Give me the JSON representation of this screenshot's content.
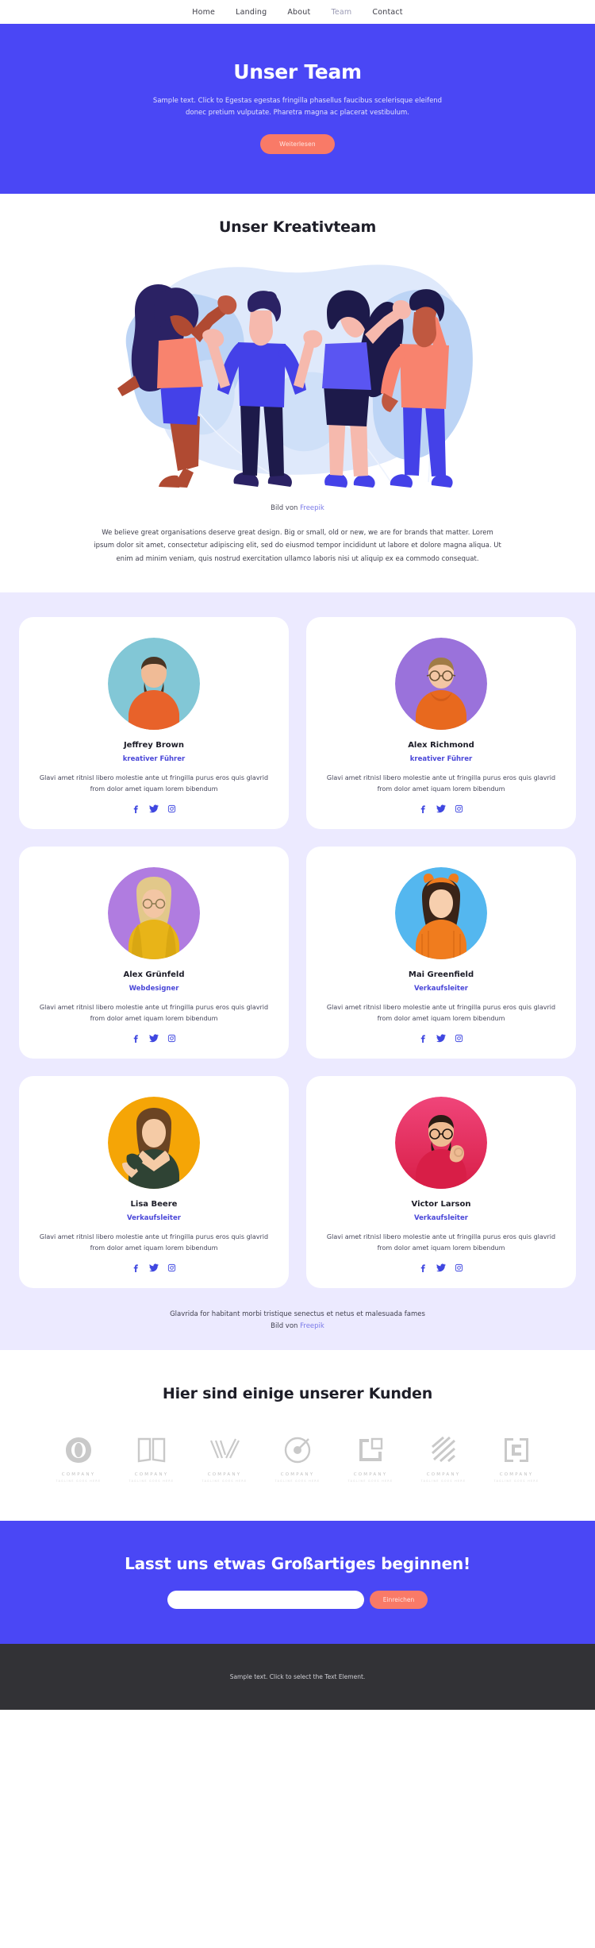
{
  "nav": {
    "items": [
      {
        "label": "Home",
        "active": false
      },
      {
        "label": "Landing",
        "active": false
      },
      {
        "label": "About",
        "active": false
      },
      {
        "label": "Team",
        "active": true
      },
      {
        "label": "Contact",
        "active": false
      }
    ]
  },
  "hero": {
    "title": "Unser Team",
    "subtitle": "Sample text. Click to Egestas egestas fringilla phasellus faucibus scelerisque eleifend donec pretium vulputate. Pharetra magna ac placerat vestibulum.",
    "button_label": "Weiterlesen",
    "bg_color": "#4a47f5",
    "button_color": "#f97a67"
  },
  "creative": {
    "title": "Unser Kreativteam",
    "illustration_name": "team-celebration-illustration",
    "caption_prefix": "Bild von ",
    "caption_link": "Freepik",
    "body": "We believe great organisations deserve great design. Big or small, old or new, we are for brands that matter. Lorem ipsum dolor sit amet, consectetur adipiscing elit, sed do eiusmod tempor incididunt ut labore et dolore magna aliqua. Ut enim ad minim veniam, quis nostrud exercitation ullamco laboris nisi ut aliquip ex ea commodo consequat."
  },
  "team": {
    "bg_color": "#eceaff",
    "role_color": "#4a47d8",
    "members": [
      {
        "name": "Jeffrey Brown",
        "role": "kreativer Führer",
        "desc": "Glavi amet ritnisl libero molestie ante ut fringilla purus eros quis glavrid from dolor amet iquam lorem bibendum",
        "avatar_bg": "#82c7d6",
        "shirt": "#e8622a",
        "hair": "#4a3524",
        "skin": "#f0bb96"
      },
      {
        "name": "Alex Richmond",
        "role": "kreativer Führer",
        "desc": "Glavi amet ritnisl libero molestie ante ut fringilla purus eros quis glavrid from dolor amet iquam lorem bibendum",
        "avatar_bg": "#9a72db",
        "shirt": "#e8691e",
        "hair": "#a07c46",
        "skin": "#f3c6a4"
      },
      {
        "name": "Alex Grünfeld",
        "role": "Webdesigner",
        "desc": "Glavi amet ritnisl libero molestie ante ut fringilla purus eros quis glavrid from dolor amet iquam lorem bibendum",
        "avatar_bg": "#b07ce0",
        "shirt": "#e8b418",
        "hair": "#e2c88a",
        "skin": "#f3c6a4"
      },
      {
        "name": "Mai Greenfield",
        "role": "Verkaufsleiter",
        "desc": "Glavi amet ritnisl libero molestie ante ut fringilla purus eros quis glavrid from dolor amet iquam lorem bibendum",
        "avatar_bg": "#54b7ef",
        "shirt": "#f07c1e",
        "hair": "#3a2418",
        "skin": "#f7cfae"
      },
      {
        "name": "Lisa Beere",
        "role": "Verkaufsleiter",
        "desc": "Glavi amet ritnisl libero molestie ante ut fringilla purus eros quis glavrid from dolor amet iquam lorem bibendum",
        "avatar_bg": "#f5a506",
        "shirt": "#2f4334",
        "hair": "#6b4423",
        "skin": "#f5cba6"
      },
      {
        "name": "Victor Larson",
        "role": "Verkaufsleiter",
        "desc": "Glavi amet ritnisl libero molestie ante ut fringilla purus eros quis glavrid from dolor amet iquam lorem bibendum",
        "avatar_bg": "#e8275f",
        "shirt": "#d81e47",
        "hair": "#2a1c14",
        "skin": "#eebb92"
      }
    ],
    "social_icons": [
      "facebook-icon",
      "twitter-icon",
      "instagram-icon"
    ],
    "footer_text": "Glavrida for habitant morbi tristique senectus et netus et malesuada fames",
    "footer_caption_prefix": "Bild von ",
    "footer_caption_link": "Freepik"
  },
  "clients": {
    "title": "Hier sind einige unserer Kunden",
    "logos": [
      {
        "mark": "ring-mark",
        "name": "COMPANY",
        "tagline": "TAGLINE GOES HERE"
      },
      {
        "mark": "book-mark",
        "name": "COMPANY",
        "tagline": "TAGLINE GOES HERE"
      },
      {
        "mark": "chevron-mark",
        "name": "COMPANY",
        "tagline": "TAGLINE GOES HERE"
      },
      {
        "mark": "circle-mark",
        "name": "COMPANY",
        "tagline": "TAGLINE GOES HERE"
      },
      {
        "mark": "square-mark",
        "name": "COMPANY",
        "tagline": "TAGLINE GOES HERE"
      },
      {
        "mark": "slash-mark",
        "name": "COMPANY",
        "tagline": "TAGLINE GOES HERE"
      },
      {
        "mark": "bracket-mark",
        "name": "COMPANY",
        "tagline": "TAGLINE GOES HERE"
      }
    ]
  },
  "cta": {
    "title": "Lasst uns etwas Großartiges beginnen!",
    "input_value": "",
    "input_placeholder": "",
    "button_label": "Einreichen",
    "bg_color": "#4a47f5",
    "button_color": "#f97a67"
  },
  "footer": {
    "text": "Sample text. Click to select the Text Element.",
    "bg_color": "#323236"
  }
}
